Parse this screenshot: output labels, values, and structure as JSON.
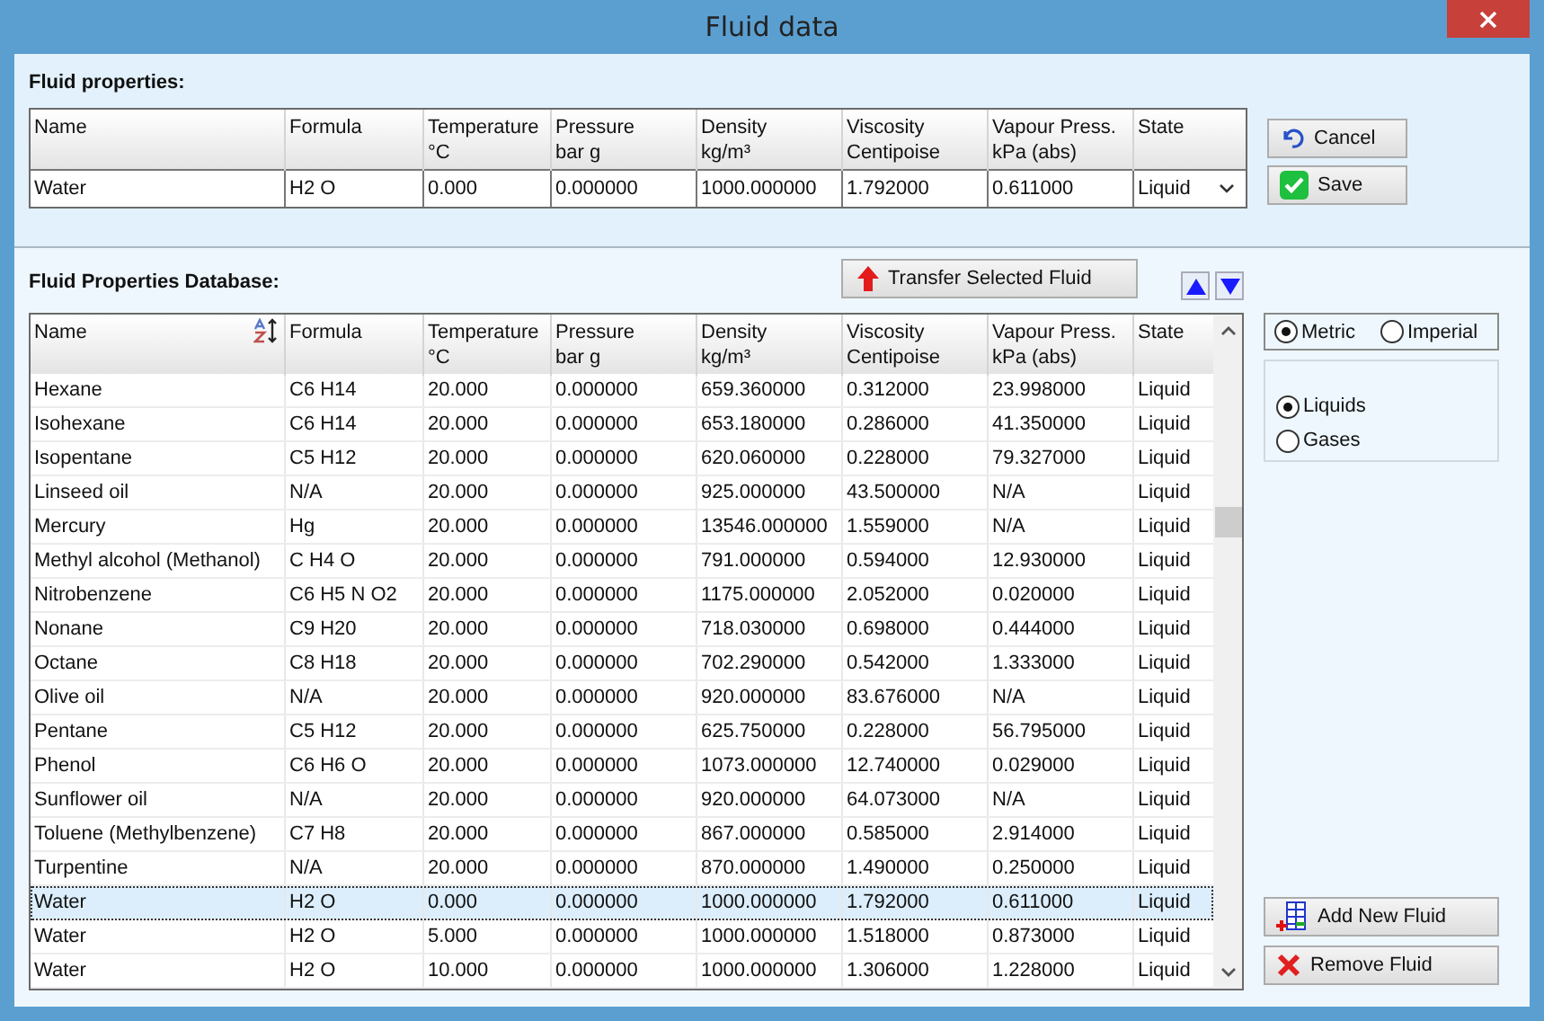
{
  "window": {
    "title": "Fluid data"
  },
  "fluid_properties": {
    "title": "Fluid properties:",
    "columns": [
      {
        "label": "Name"
      },
      {
        "label": "Formula"
      },
      {
        "label": "Temperature",
        "unit": "°C"
      },
      {
        "label": "Pressure",
        "unit": "bar g"
      },
      {
        "label": "Density",
        "unit": "kg/m³"
      },
      {
        "label": "Viscosity",
        "unit": "Centipoise"
      },
      {
        "label": "Vapour Press.",
        "unit": "kPa (abs)"
      },
      {
        "label": "State"
      }
    ],
    "row": {
      "cells": [
        "Water",
        "H2 O",
        "0.000",
        "0.000000",
        "1000.000000",
        "1.792000",
        "0.611000"
      ],
      "state": "Liquid"
    },
    "buttons": [
      {
        "kind": "cancel",
        "label": "Cancel"
      },
      {
        "kind": "save",
        "label": "Save"
      }
    ]
  },
  "database": {
    "title": "Fluid Properties Database:",
    "transfer_button": "Transfer Selected Fluid",
    "columns": [
      {
        "label": "Name",
        "sorted": true
      },
      {
        "label": "Formula",
        "sorted": false
      },
      {
        "label": "Temperature",
        "unit": "°C",
        "sorted": false
      },
      {
        "label": "Pressure",
        "unit": "bar g",
        "sorted": false
      },
      {
        "label": "Density",
        "unit": "kg/m³",
        "sorted": false
      },
      {
        "label": "Viscosity",
        "unit": "Centipoise",
        "sorted": false
      },
      {
        "label": "Vapour Press.",
        "unit": "kPa (abs)",
        "sorted": false
      },
      {
        "label": "State",
        "sorted": false
      }
    ],
    "rows": [
      {
        "cells": [
          "Hexane",
          "C6 H14",
          "20.000",
          "0.000000",
          "659.360000",
          "0.312000",
          "23.998000",
          "Liquid"
        ],
        "selected": false
      },
      {
        "cells": [
          "Isohexane",
          "C6 H14",
          "20.000",
          "0.000000",
          "653.180000",
          "0.286000",
          "41.350000",
          "Liquid"
        ],
        "selected": false
      },
      {
        "cells": [
          "Isopentane",
          "C5 H12",
          "20.000",
          "0.000000",
          "620.060000",
          "0.228000",
          "79.327000",
          "Liquid"
        ],
        "selected": false
      },
      {
        "cells": [
          "Linseed oil",
          "N/A",
          "20.000",
          "0.000000",
          "925.000000",
          "43.500000",
          "N/A",
          "Liquid"
        ],
        "selected": false
      },
      {
        "cells": [
          "Mercury",
          "Hg",
          "20.000",
          "0.000000",
          "13546.000000",
          "1.559000",
          "N/A",
          "Liquid"
        ],
        "selected": false
      },
      {
        "cells": [
          "Methyl alcohol (Methanol)",
          "C H4 O",
          "20.000",
          "0.000000",
          "791.000000",
          "0.594000",
          "12.930000",
          "Liquid"
        ],
        "selected": false
      },
      {
        "cells": [
          "Nitrobenzene",
          "C6 H5 N O2",
          "20.000",
          "0.000000",
          "1175.000000",
          "2.052000",
          "0.020000",
          "Liquid"
        ],
        "selected": false
      },
      {
        "cells": [
          "Nonane",
          "C9 H20",
          "20.000",
          "0.000000",
          "718.030000",
          "0.698000",
          "0.444000",
          "Liquid"
        ],
        "selected": false
      },
      {
        "cells": [
          "Octane",
          "C8 H18",
          "20.000",
          "0.000000",
          "702.290000",
          "0.542000",
          "1.333000",
          "Liquid"
        ],
        "selected": false
      },
      {
        "cells": [
          "Olive oil",
          "N/A",
          "20.000",
          "0.000000",
          "920.000000",
          "83.676000",
          "N/A",
          "Liquid"
        ],
        "selected": false
      },
      {
        "cells": [
          "Pentane",
          "C5 H12",
          "20.000",
          "0.000000",
          "625.750000",
          "0.228000",
          "56.795000",
          "Liquid"
        ],
        "selected": false
      },
      {
        "cells": [
          "Phenol",
          "C6 H6 O",
          "20.000",
          "0.000000",
          "1073.000000",
          "12.740000",
          "0.029000",
          "Liquid"
        ],
        "selected": false
      },
      {
        "cells": [
          "Sunflower oil",
          "N/A",
          "20.000",
          "0.000000",
          "920.000000",
          "64.073000",
          "N/A",
          "Liquid"
        ],
        "selected": false
      },
      {
        "cells": [
          "Toluene (Methylbenzene)",
          "C7 H8",
          "20.000",
          "0.000000",
          "867.000000",
          "0.585000",
          "2.914000",
          "Liquid"
        ],
        "selected": false
      },
      {
        "cells": [
          "Turpentine",
          "N/A",
          "20.000",
          "0.000000",
          "870.000000",
          "1.490000",
          "0.250000",
          "Liquid"
        ],
        "selected": false
      },
      {
        "cells": [
          "Water",
          "H2 O",
          "0.000",
          "0.000000",
          "1000.000000",
          "1.792000",
          "0.611000",
          "Liquid"
        ],
        "selected": true
      },
      {
        "cells": [
          "Water",
          "H2 O",
          "5.000",
          "0.000000",
          "1000.000000",
          "1.518000",
          "0.873000",
          "Liquid"
        ],
        "selected": false
      },
      {
        "cells": [
          "Water",
          "H2 O",
          "10.000",
          "0.000000",
          "1000.000000",
          "1.306000",
          "1.228000",
          "Liquid"
        ],
        "selected": false
      }
    ],
    "unit_system": [
      {
        "label": "Metric",
        "selected": true
      },
      {
        "label": "Imperial",
        "selected": false
      }
    ],
    "fluid_type": [
      {
        "label": "Liquids",
        "selected": true
      },
      {
        "label": "Gases",
        "selected": false
      }
    ],
    "buttons": [
      {
        "kind": "add",
        "label": "Add New Fluid"
      },
      {
        "kind": "remove",
        "label": "Remove Fluid"
      }
    ]
  }
}
